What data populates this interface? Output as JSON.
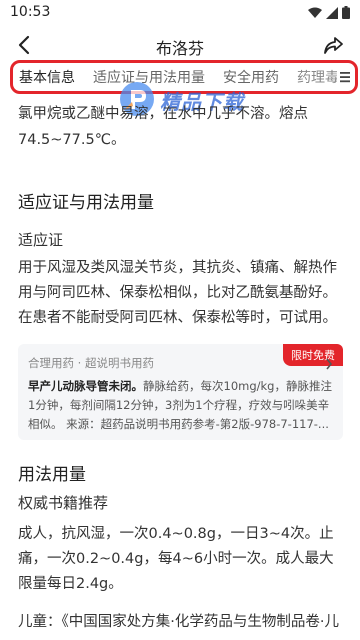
{
  "status_bar": {
    "time": "10:53"
  },
  "header": {
    "title": "布洛芬"
  },
  "tabs": [
    {
      "label": "基本信息"
    },
    {
      "label": "适应证与用法用量"
    },
    {
      "label": "安全用药"
    },
    {
      "label": "药理毒"
    }
  ],
  "watermark": {
    "text": "精品下载"
  },
  "content": {
    "intro_line1": "氯甲烷或乙醚中易溶，在水中几乎不溶。熔点",
    "intro_line2": "74.5~77.5℃。",
    "section_indications": "适应证与用法用量",
    "sub_indications": "适应证",
    "indications_text": "用于风湿及类风湿关节炎，其抗炎、镇痛、解热作用与阿司匹林、保泰松相似，比对乙酰氨基酚好。在患者不能耐受阿司匹林、保泰松等时，可试用。",
    "card": {
      "header": "合理用药 · 超说明书用药",
      "badge": "限时免费",
      "bold_text": "早产儿动脉导管未闭。",
      "body_text": "静脉给药，每次10mg/kg，静脉推注1分钟，每剂间隔12分钟，3剂为1个疗程，疗效与吲哚美辛相似。 来源：超药品说明书用药参考-第2版-978-7-117-..."
    },
    "section_dosage": "用法用量",
    "sub_dosage": "权威书籍推荐",
    "dosage_text": "成人，抗风湿，一次0.4~0.8g，一日3~4次。止痛，一次0.2~0.4g，每4~6小时一次。成人最大限量每日2.4g。",
    "children_line": "儿童：《中国国家处方集·化学药品与生物制品卷·儿"
  }
}
